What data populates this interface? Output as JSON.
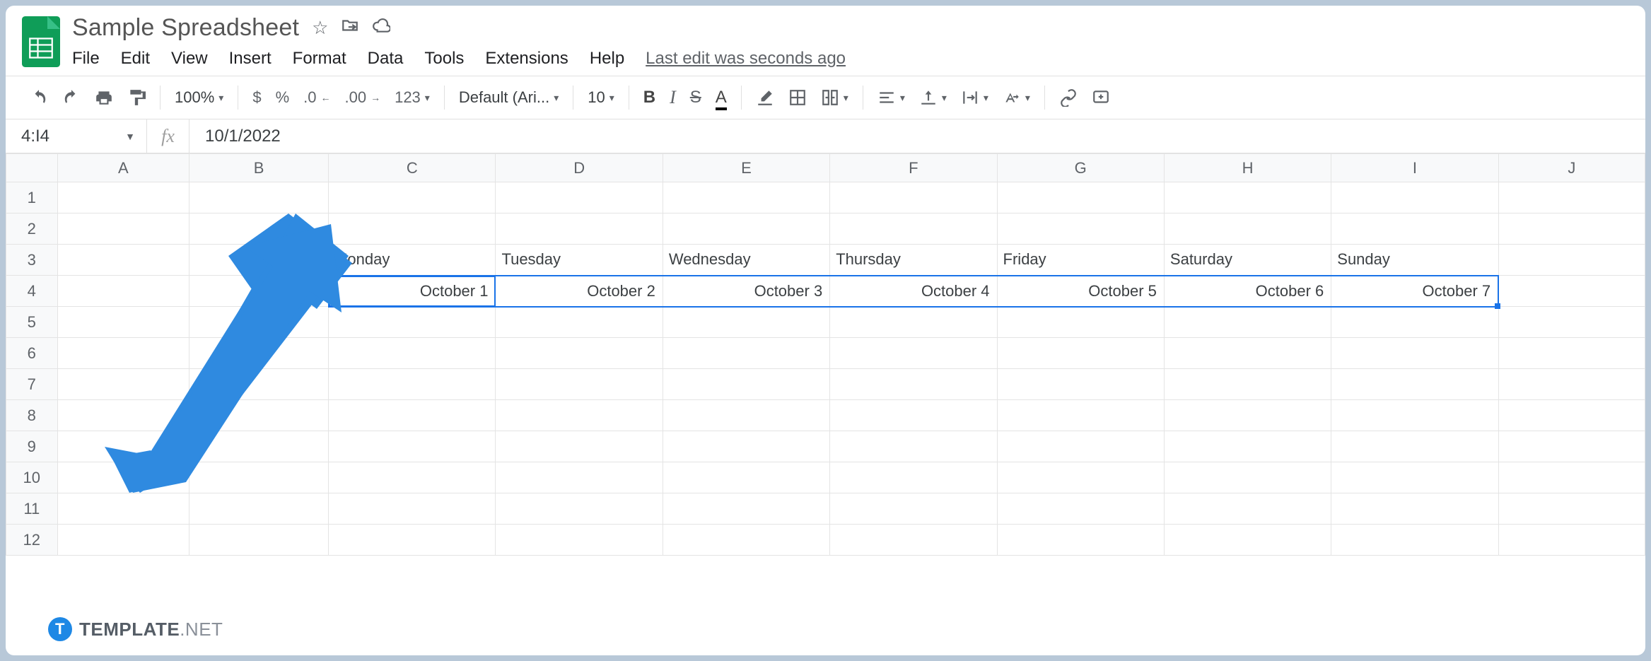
{
  "header": {
    "doc_title": "Sample Spreadsheet",
    "menu": [
      "File",
      "Edit",
      "View",
      "Insert",
      "Format",
      "Data",
      "Tools",
      "Extensions",
      "Help"
    ],
    "last_edit": "Last edit was seconds ago"
  },
  "toolbar": {
    "zoom": "100%",
    "currency": "$",
    "percent": "%",
    "dec_dec": ".0",
    "inc_dec": ".00",
    "num_fmt": "123",
    "font": "Default (Ari...",
    "font_size": "10",
    "bold": "B",
    "italic": "I",
    "strike": "S",
    "text_color": "A"
  },
  "name_box": "4:I4",
  "fx": "fx",
  "formula_value": "10/1/2022",
  "columns": [
    "A",
    "B",
    "C",
    "D",
    "E",
    "F",
    "G",
    "H",
    "I",
    "J"
  ],
  "rows": [
    "1",
    "2",
    "3",
    "4",
    "5",
    "6",
    "7",
    "8",
    "9",
    "10",
    "11",
    "12"
  ],
  "row3": {
    "C": "Monday",
    "D": "Tuesday",
    "E": "Wednesday",
    "F": "Thursday",
    "G": "Friday",
    "H": "Saturday",
    "I": "Sunday"
  },
  "row4": {
    "C": "October 1",
    "D": "October 2",
    "E": "October 3",
    "F": "October 4",
    "G": "October 5",
    "H": "October 6",
    "I": "October 7"
  },
  "watermark": {
    "brand": "TEMPLATE",
    "suffix": ".NET",
    "icon_letter": "T"
  }
}
